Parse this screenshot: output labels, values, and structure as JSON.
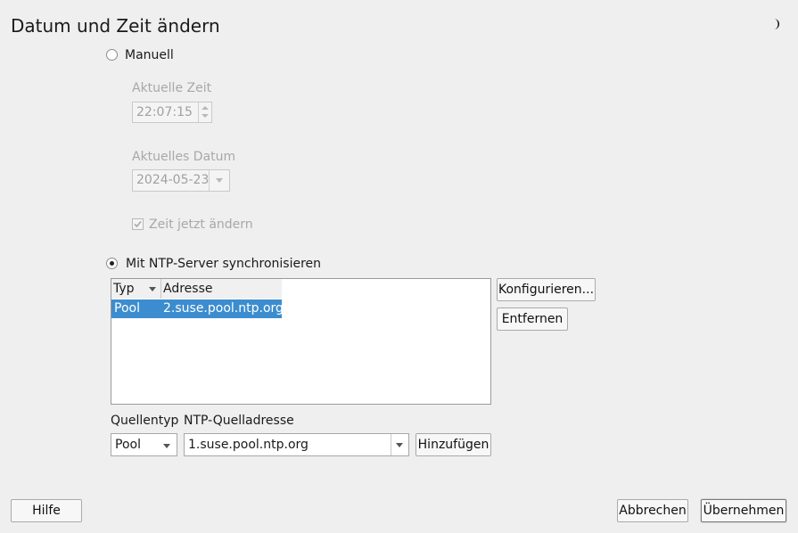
{
  "dialog": {
    "title": "Datum und Zeit ändern",
    "theme_icon": "moon-icon"
  },
  "manual": {
    "radio_label": "Manuell",
    "time_label": "Aktuelle Zeit",
    "time_value": "22:07:15",
    "date_label": "Aktuelles Datum",
    "date_value": "2024-05-23",
    "change_now_label": "Zeit jetzt ändern",
    "change_now_checked": true
  },
  "ntp": {
    "radio_label": "Mit NTP-Server synchronisieren",
    "table": {
      "columns": [
        "Typ",
        "Adresse"
      ],
      "rows": [
        {
          "type": "Pool",
          "address": "2.suse.pool.ntp.org"
        }
      ]
    },
    "configure_button": "Konfigurieren...",
    "remove_button": "Entfernen",
    "source_type_label": "Quellentyp",
    "source_type_value": "Pool",
    "source_address_label": "NTP-Quelladresse",
    "source_address_value": "1.suse.pool.ntp.org",
    "add_button": "Hinzufügen"
  },
  "footer": {
    "help_button": "Hilfe",
    "cancel_button": "Abbrechen",
    "apply_button": "Übernehmen"
  }
}
